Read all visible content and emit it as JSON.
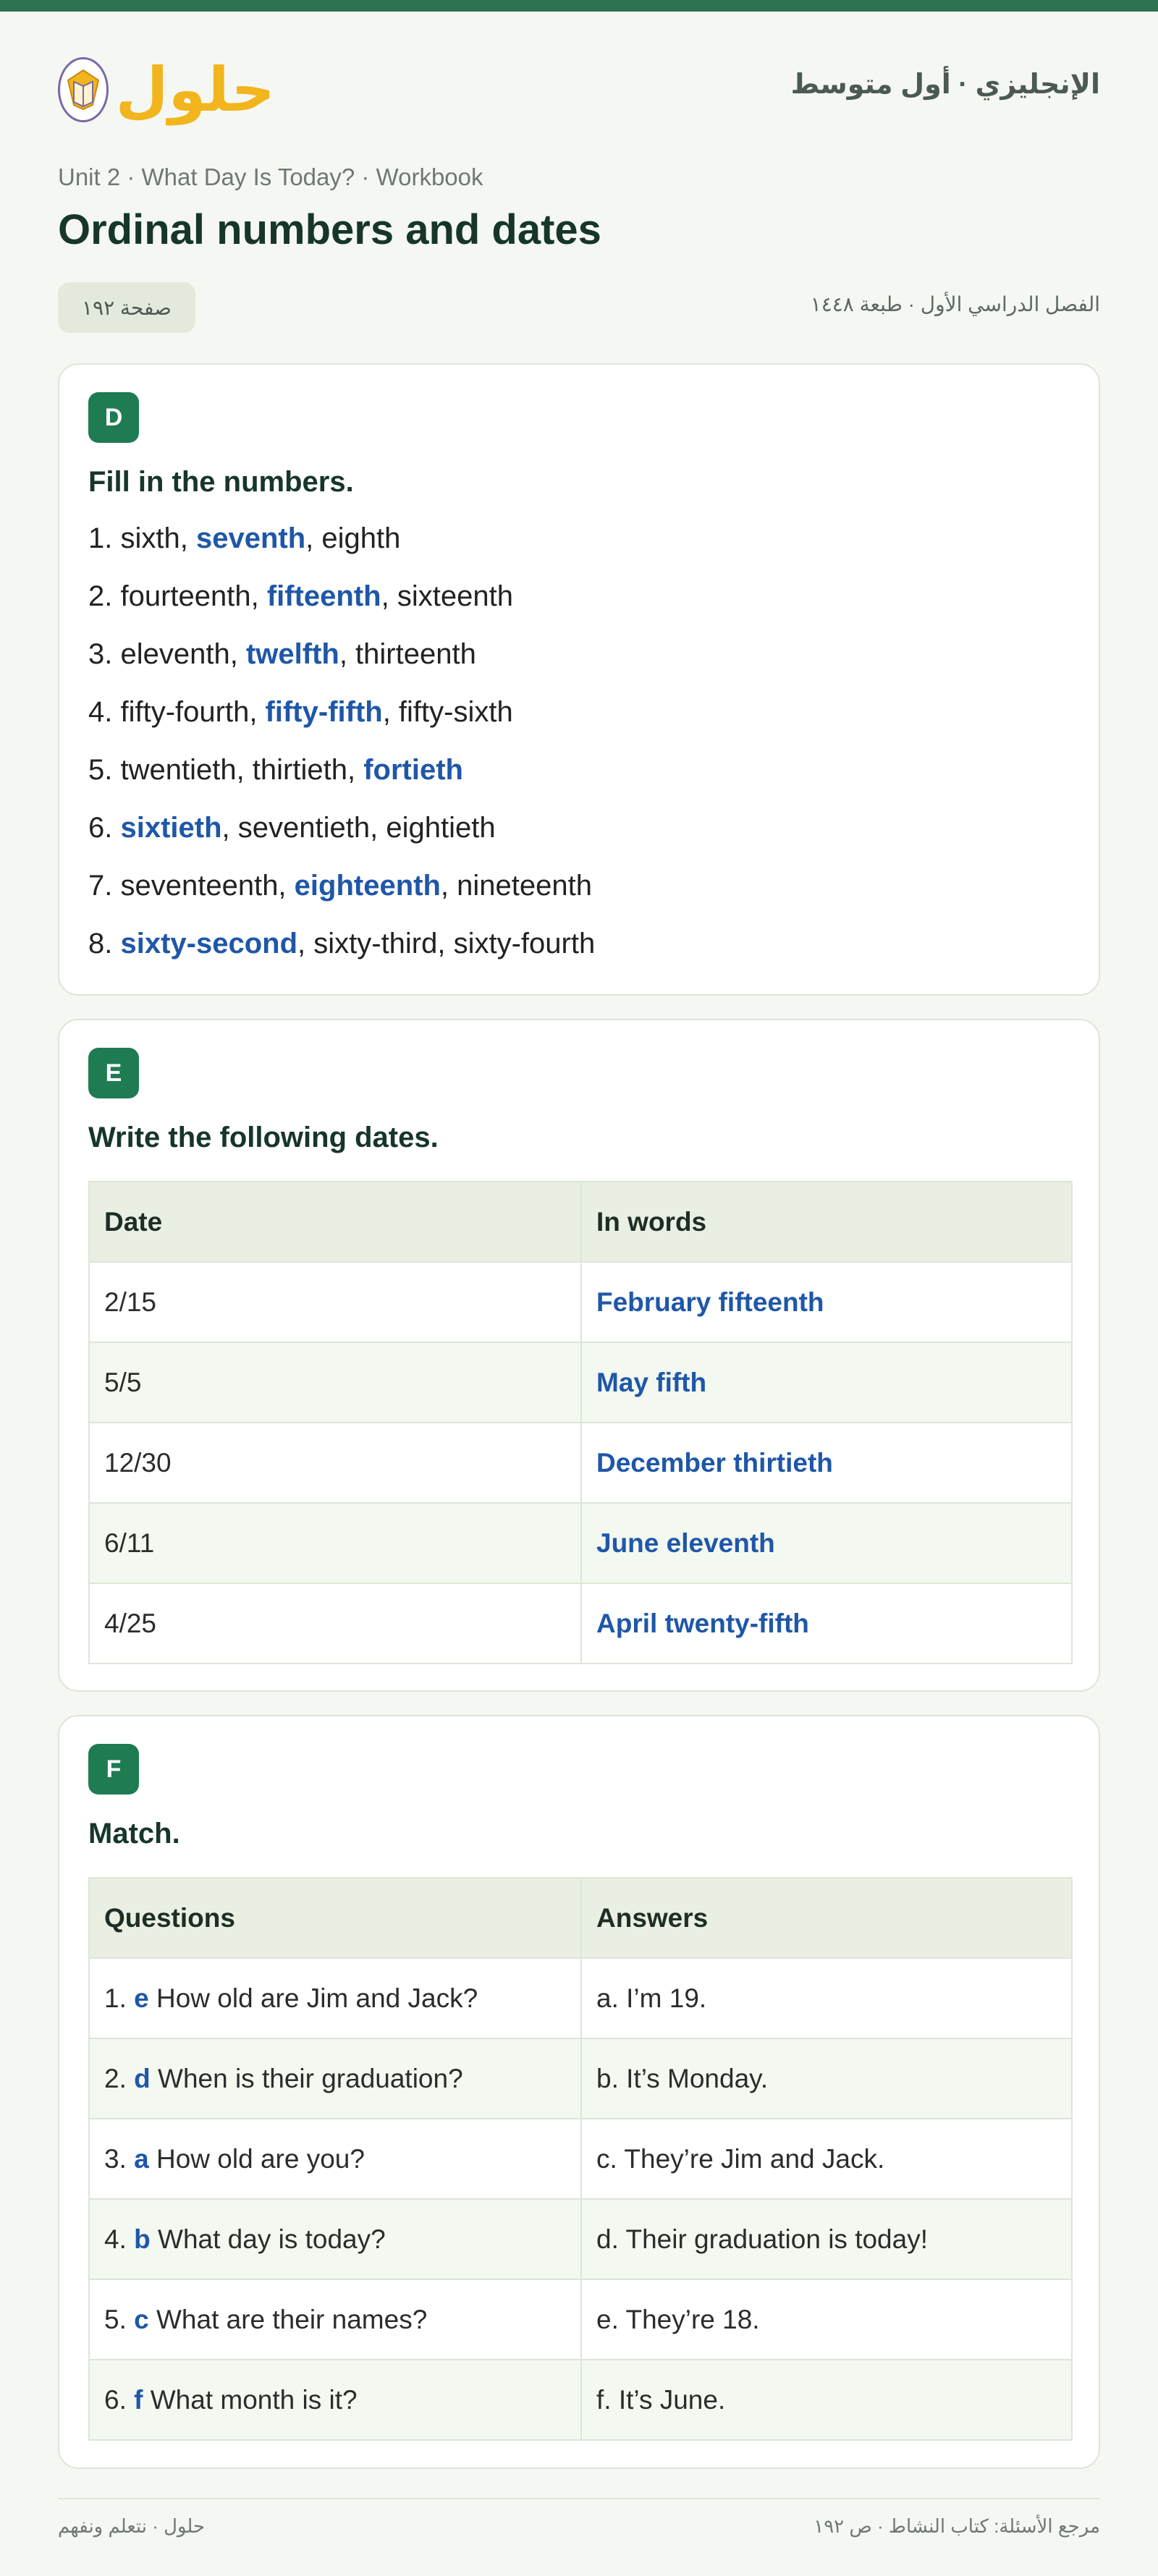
{
  "colors": {
    "accent": "#1e7b52",
    "answer": "#1f57a8",
    "logo": "#f2b51d",
    "topbar": "#2e7150"
  },
  "header": {
    "logo_text": "حلول",
    "logo_icon": "book-icon",
    "title": "الإنجليزي · أول متوسط"
  },
  "breadcrumb": "Unit 2 · What Day Is Today? · Workbook",
  "page_title": "Ordinal numbers and dates",
  "page_badge": "صفحة ١٩٢",
  "edition": "الفصل الدراسي الأول · طبعة ١٤٤٨",
  "section_d": {
    "letter": "D",
    "instruction": "Fill in the numbers.",
    "items": [
      {
        "num": "1. ",
        "before": "sixth, ",
        "answer": "seventh",
        "after": ", eighth"
      },
      {
        "num": "2. ",
        "before": "fourteenth, ",
        "answer": "fifteenth",
        "after": ", sixteenth"
      },
      {
        "num": "3. ",
        "before": "eleventh, ",
        "answer": "twelfth",
        "after": ", thirteenth"
      },
      {
        "num": "4. ",
        "before": "fifty-fourth, ",
        "answer": "fifty-fifth",
        "after": ", fifty-sixth"
      },
      {
        "num": "5. ",
        "before": "twentieth, thirtieth, ",
        "answer": "fortieth",
        "after": ""
      },
      {
        "num": "6. ",
        "before": "",
        "answer": "sixtieth",
        "after": ", seventieth, eightieth"
      },
      {
        "num": "7. ",
        "before": "seventeenth, ",
        "answer": "eighteenth",
        "after": ", nineteenth"
      },
      {
        "num": "8. ",
        "before": "",
        "answer": "sixty-second",
        "after": ", sixty-third, sixty-fourth"
      }
    ]
  },
  "section_e": {
    "letter": "E",
    "instruction": "Write the following dates.",
    "headers": [
      "Date",
      "In words"
    ],
    "rows": [
      {
        "date": "2/15",
        "words": "February fifteenth"
      },
      {
        "date": "5/5",
        "words": "May fifth"
      },
      {
        "date": "12/30",
        "words": "December thirtieth"
      },
      {
        "date": "6/11",
        "words": "June eleventh"
      },
      {
        "date": "4/25",
        "words": "April twenty-fifth"
      }
    ]
  },
  "section_f": {
    "letter": "F",
    "instruction": "Match.",
    "headers": [
      "Questions",
      "Answers"
    ],
    "rows": [
      {
        "num": "1. ",
        "letter": "e",
        "question": " How old are Jim and Jack?",
        "answer": "a. I’m 19."
      },
      {
        "num": "2. ",
        "letter": "d",
        "question": " When is their graduation?",
        "answer": "b. It’s Monday."
      },
      {
        "num": "3. ",
        "letter": "a",
        "question": " How old are you?",
        "answer": "c. They’re Jim and Jack."
      },
      {
        "num": "4. ",
        "letter": "b",
        "question": " What day is today?",
        "answer": "d. Their graduation is today!"
      },
      {
        "num": "5. ",
        "letter": "c",
        "question": " What are their names?",
        "answer": "e. They’re 18."
      },
      {
        "num": "6. ",
        "letter": "f",
        "question": " What month is it?",
        "answer": "f. It’s June."
      }
    ]
  },
  "footer": {
    "left": "حلول · نتعلم ونفهم",
    "right": "مرجع الأسئلة: كتاب النشاط · ص ١٩٢"
  }
}
